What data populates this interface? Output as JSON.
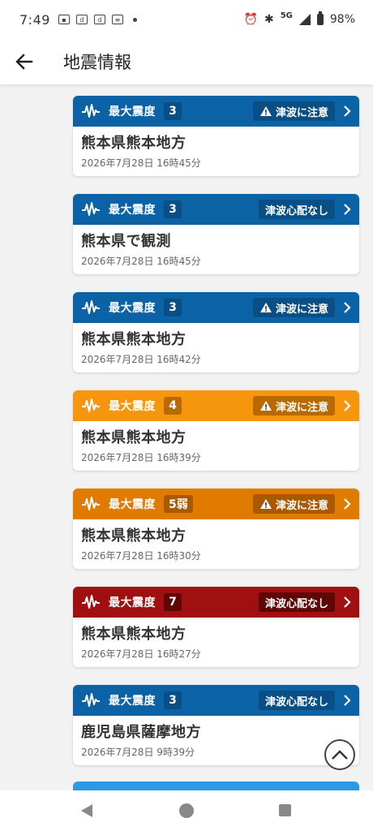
{
  "status_bar": {
    "time": "7:49",
    "network": "5G",
    "battery": "98%"
  },
  "app_bar": {
    "title": "地震情報"
  },
  "label_max_intensity": "最大震度",
  "earthquakes": [
    {
      "theme": "blue",
      "intensity": "3",
      "tsunami": "津波に注意",
      "tsunami_warning": true,
      "place": "熊本県熊本地方",
      "time": "2026年7月28日 16時45分"
    },
    {
      "theme": "blue",
      "intensity": "3",
      "tsunami": "津波心配なし",
      "tsunami_warning": false,
      "place": "熊本県で観測",
      "time": "2026年7月28日 16時45分"
    },
    {
      "theme": "blue",
      "intensity": "3",
      "tsunami": "津波に注意",
      "tsunami_warning": true,
      "place": "熊本県熊本地方",
      "time": "2026年7月28日 16時42分"
    },
    {
      "theme": "orange",
      "intensity": "4",
      "tsunami": "津波に注意",
      "tsunami_warning": true,
      "place": "熊本県熊本地方",
      "time": "2026年7月28日 16時39分"
    },
    {
      "theme": "dark-orange",
      "intensity": "5弱",
      "tsunami": "津波に注意",
      "tsunami_warning": true,
      "place": "熊本県熊本地方",
      "time": "2026年7月28日 16時30分"
    },
    {
      "theme": "red",
      "intensity": "7",
      "tsunami": "津波心配なし",
      "tsunami_warning": false,
      "place": "熊本県熊本地方",
      "time": "2026年7月28日 16時27分"
    },
    {
      "theme": "blue",
      "intensity": "3",
      "tsunami": "津波心配なし",
      "tsunami_warning": false,
      "place": "鹿児島県薩摩地方",
      "time": "2026年7月28日 9時39分"
    }
  ],
  "themes": {
    "blue": {
      "header": "#0b62a4",
      "badge": "#094e85",
      "badge_text": "#ffffff"
    },
    "orange": {
      "header": "#f5960c",
      "badge": "#b86a00",
      "badge_text": "#ffffff"
    },
    "dark-orange": {
      "header": "#e07b00",
      "badge": "#a95a00",
      "badge_text": "#ffffff"
    },
    "red": {
      "header": "#a01010",
      "badge": "#5e0707",
      "badge_text": "#ffffff"
    }
  },
  "icons": [
    "back-arrow-icon",
    "seismic-wave-icon",
    "warning-icon",
    "chevron-right-icon",
    "chevron-up-icon"
  ]
}
